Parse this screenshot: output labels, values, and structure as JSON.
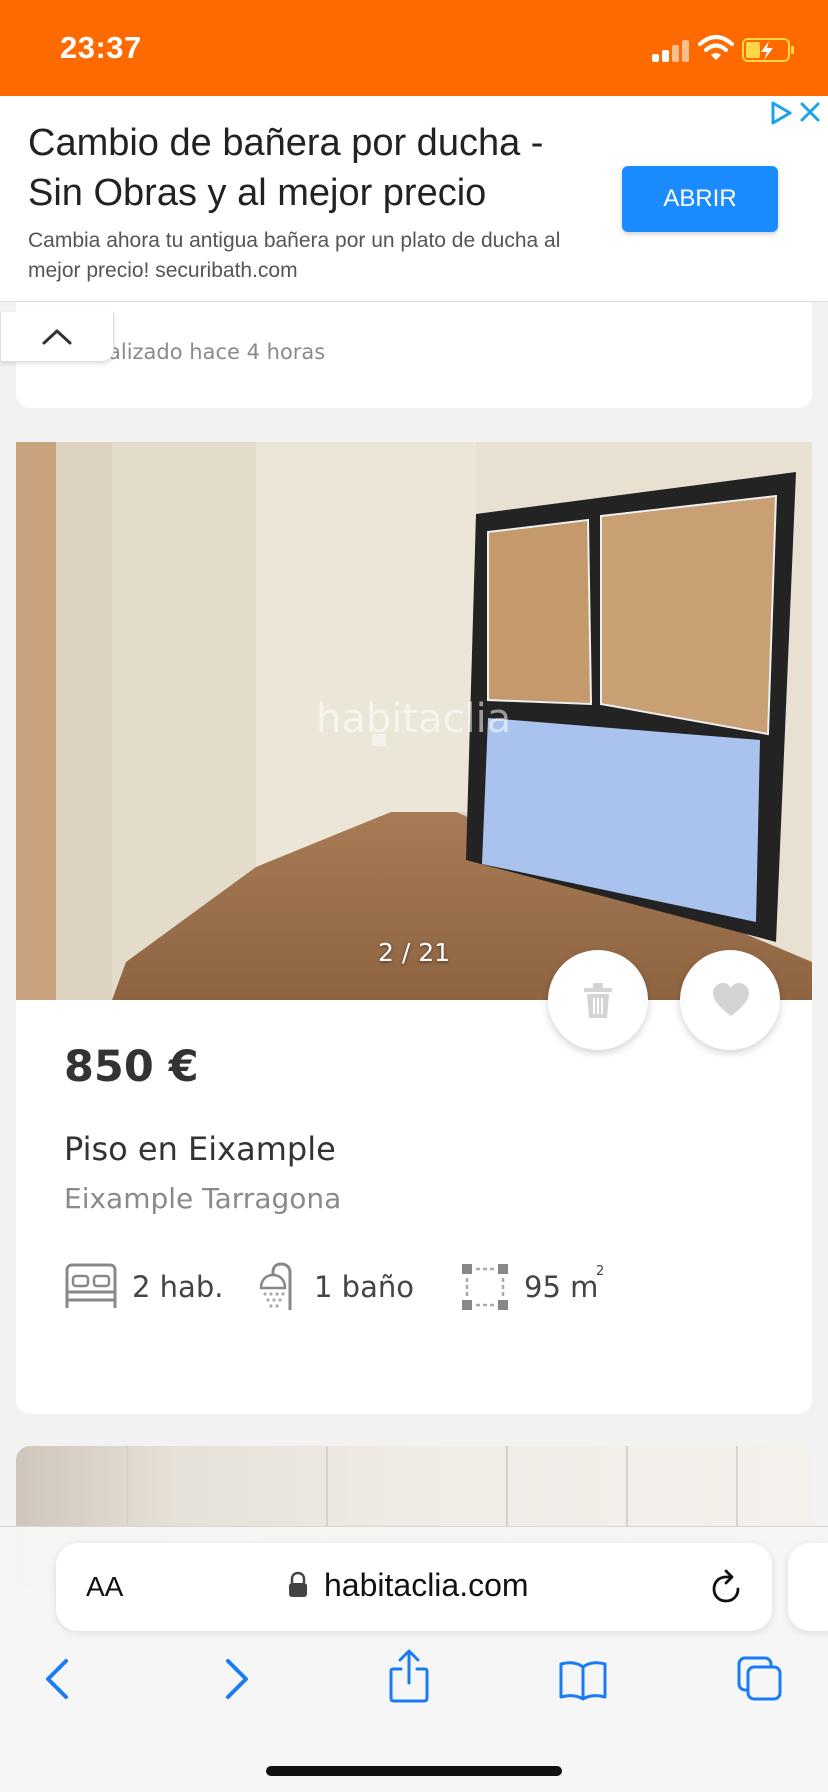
{
  "status_bar": {
    "time": "23:37",
    "background_color": "#ff6a00"
  },
  "ad": {
    "title": "Cambio de bañera por ducha - Sin Obras y al mejor precio",
    "description": "Cambia ahora tu antigua bañera por un plato de ducha al mejor precio! securibath.com",
    "button_label": "ABRIR",
    "button_color": "#1a8cff"
  },
  "previous_listing": {
    "updated_text": "alizado hace 4 horas"
  },
  "listing": {
    "photo_counter": "2 / 21",
    "photo_watermark": "habitaclia",
    "price": "850 €",
    "title": "Piso en Eixample",
    "location": "Eixample Tarragona",
    "features": {
      "rooms": "2 hab.",
      "bathrooms": "1 baño",
      "area": "95 m",
      "area_superscript": "2"
    }
  },
  "browser": {
    "text_size_label": "AA",
    "url": "habitaclia.com",
    "icons": [
      "back-icon",
      "forward-icon",
      "share-icon",
      "bookmarks-icon",
      "tabs-icon"
    ],
    "accent_color": "#1a7cf2"
  }
}
